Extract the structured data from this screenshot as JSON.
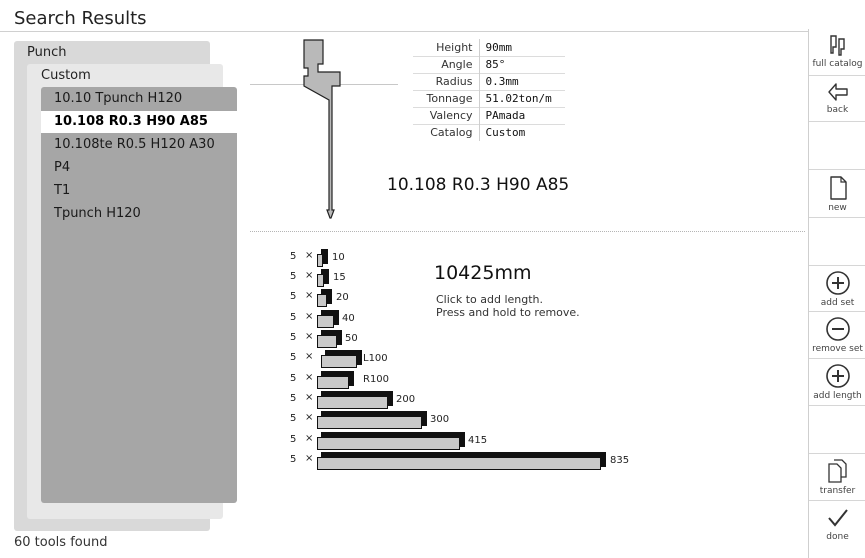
{
  "header": {
    "title": "Search Results"
  },
  "tree": {
    "root": "Punch",
    "group": "Custom",
    "items": [
      {
        "label": "10.10 Tpunch H120",
        "selected": false
      },
      {
        "label": "10.108 R0.3 H90 A85",
        "selected": true
      },
      {
        "label": "10.108te R0.5 H120 A30",
        "selected": false
      },
      {
        "label": "P4",
        "selected": false
      },
      {
        "label": "T1",
        "selected": false
      },
      {
        "label": "Tpunch H120",
        "selected": false
      }
    ]
  },
  "footer": {
    "count_text": "60 tools found"
  },
  "properties": [
    {
      "key": "Height",
      "value": "90mm"
    },
    {
      "key": "Angle",
      "value": "85°"
    },
    {
      "key": "Radius",
      "value": "0.3mm"
    },
    {
      "key": "Tonnage",
      "value": "51.02ton/m"
    },
    {
      "key": "Valency",
      "value": "PAmada"
    },
    {
      "key": "Catalog",
      "value": "Custom"
    }
  ],
  "tool_name": "10.108 R0.3 H90 A85",
  "segments": {
    "total": "10425mm",
    "hint_line1": "Click to add length.",
    "hint_line2": "Press and hold to remove.",
    "multiplier": "×",
    "rows": [
      {
        "count": "5",
        "label": "10"
      },
      {
        "count": "5",
        "label": "15"
      },
      {
        "count": "5",
        "label": "20"
      },
      {
        "count": "5",
        "label": "40"
      },
      {
        "count": "5",
        "label": "50"
      },
      {
        "count": "5",
        "label": "L100"
      },
      {
        "count": "5",
        "label": "R100"
      },
      {
        "count": "5",
        "label": "200"
      },
      {
        "count": "5",
        "label": "300"
      },
      {
        "count": "5",
        "label": "415"
      },
      {
        "count": "5",
        "label": "835"
      }
    ]
  },
  "toolbar": {
    "full_catalog": "full catalog",
    "back": "back",
    "new": "new",
    "add_set": "add set",
    "remove_set": "remove set",
    "add_length": "add length",
    "transfer": "transfer",
    "done": "done"
  }
}
